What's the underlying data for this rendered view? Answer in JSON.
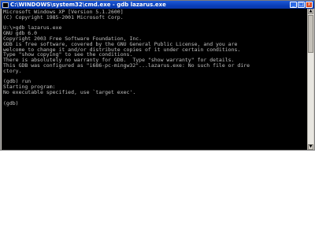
{
  "window": {
    "title": "C:\\WINDOWS\\system32\\cmd.exe - gdb lazarus.exe",
    "buttons": {
      "minimize": "_",
      "maximize": "□",
      "close": "x"
    }
  },
  "console": {
    "lines": [
      "Microsoft Windows XP [Version 5.1.2600]",
      "(C) Copyright 1985-2001 Microsoft Corp.",
      "",
      "U:\\>gdb lazarus.exe",
      "GNU gdb 6.0",
      "Copyright 2003 Free Software Foundation, Inc.",
      "GDB is free software, covered by the GNU General Public License, and you are",
      "welcome to change it and/or distribute copies of it under certain conditions.",
      "Type \"show copying\" to see the conditions.",
      "There is absolutely no warranty for GDB.  Type \"show warranty\" for details.",
      "This GDB was configured as \"i686-pc-mingw32\"...lazarus.exe: No such file or dire",
      "ctory.",
      "",
      "(gdb) run",
      "Starting program:",
      "No executable specified, use `target exec'.",
      "",
      "(gdb)"
    ]
  },
  "scrollbar": {
    "up_arrow": "▲",
    "down_arrow": "▼"
  }
}
